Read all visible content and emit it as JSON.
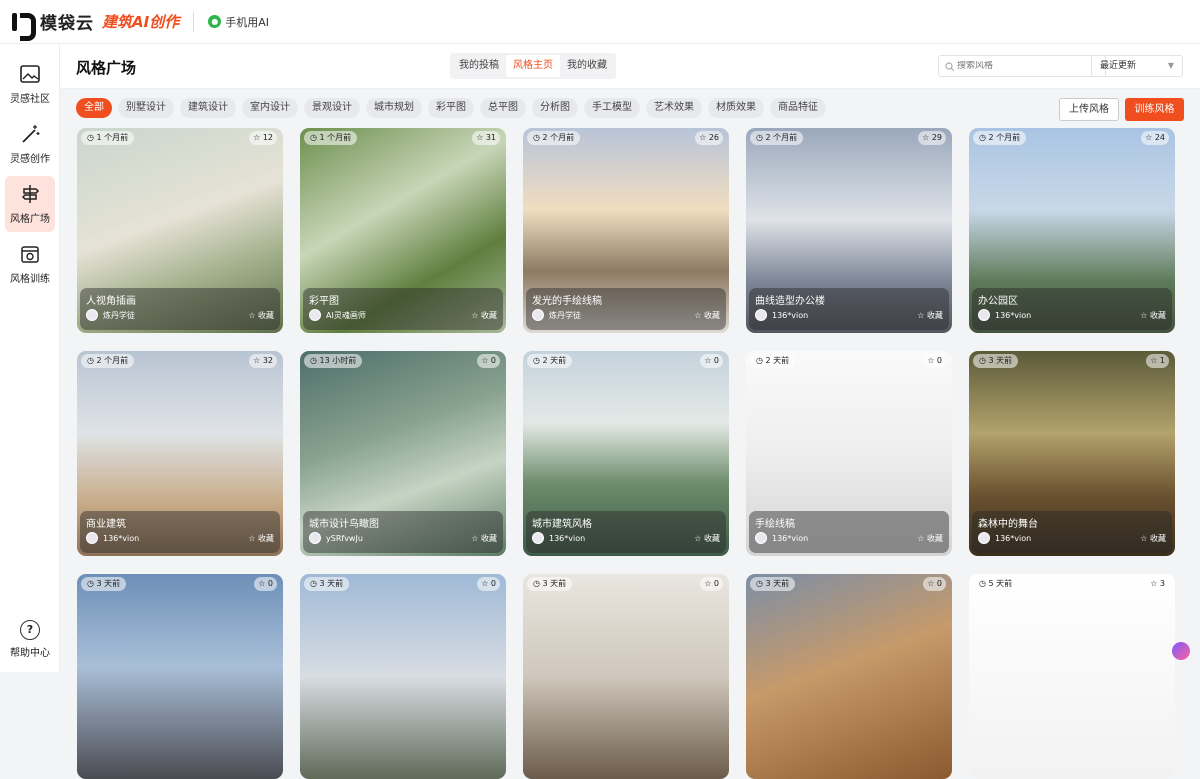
{
  "brand": {
    "name": "模袋云",
    "tagline": "建筑AI创作",
    "mobile_label": "手机用AI"
  },
  "sidebar": {
    "items": [
      {
        "label": "灵感社区"
      },
      {
        "label": "灵感创作"
      },
      {
        "label": "风格广场"
      },
      {
        "label": "风格训练"
      }
    ],
    "help_label": "帮助中心"
  },
  "header": {
    "title": "风格广场",
    "tabs": [
      {
        "label": "我的投稿"
      },
      {
        "label": "风格主页"
      },
      {
        "label": "我的收藏"
      }
    ],
    "search_placeholder": "搜索风格",
    "sort_value": "最近更新"
  },
  "categories": [
    "全部",
    "别墅设计",
    "建筑设计",
    "室内设计",
    "景观设计",
    "城市规划",
    "彩平图",
    "总平图",
    "分析图",
    "手工模型",
    "艺术效果",
    "材质效果",
    "商品特征"
  ],
  "buttons": {
    "upload": "上传风格",
    "train": "训练风格"
  },
  "fav_label": "收藏",
  "cards": [
    {
      "time": "1 个月前",
      "likes": "12",
      "title": "人视角插画",
      "user": "炼丹学徒",
      "bg": "linear-gradient(160deg,#c9d6cc 0%,#e6e2d6 45%,#a3b08c 70%,#5f6f4b 100%)"
    },
    {
      "time": "1 个月前",
      "likes": "31",
      "title": "彩平图",
      "user": "AI灵魂画师",
      "bg": "linear-gradient(150deg,#6d8f4e 0%,#c8d6b8 40%,#5f7f3e 70%,#a9b89a 100%)"
    },
    {
      "time": "2 个月前",
      "likes": "26",
      "title": "发光的手绘线稿",
      "user": "炼丹学徒",
      "bg": "linear-gradient(180deg,#b8c4d8 0%,#f1ddc0 40%,#8e7a63 70%,#dedad4 100%)"
    },
    {
      "time": "2 个月前",
      "likes": "29",
      "title": "曲线造型办公楼",
      "user": "136*vion",
      "bg": "linear-gradient(180deg,#9aa8bc 0%,#dfe3e8 45%,#7d8596 75%,#55565e 100%)"
    },
    {
      "time": "2 个月前",
      "likes": "24",
      "title": "办公园区",
      "user": "136*vion",
      "bg": "linear-gradient(180deg,#a9c4e3 0%,#c9d8e8 40%,#5e7a58 75%,#44513f 100%)"
    },
    {
      "time": "2 个月前",
      "likes": "32",
      "title": "商业建筑",
      "user": "136*vion",
      "bg": "linear-gradient(180deg,#b9c4d2 0%,#dfe3e7 40%,#c7a986 75%,#8c7258 100%)"
    },
    {
      "time": "13 小时前",
      "likes": "0",
      "title": "城市设计鸟瞰图",
      "user": "ySRfvwJu",
      "bg": "linear-gradient(160deg,#4f6e6b 0%,#88a28f 40%,#c6d4c4 65%,#5a7b63 100%)"
    },
    {
      "time": "2 天前",
      "likes": "0",
      "title": "城市建筑风格",
      "user": "136*vion",
      "bg": "linear-gradient(180deg,#c4d2dc 0%,#e4e9e6 35%,#6c8c6a 65%,#3f5a49 100%)"
    },
    {
      "time": "2 天前",
      "likes": "0",
      "title": "手绘线稿",
      "user": "136*vion",
      "bg": "linear-gradient(180deg,#fafafa 0%,#eeeeee 50%,#d4d4d4 100%)"
    },
    {
      "time": "3 天前",
      "likes": "1",
      "title": "森林中的舞台",
      "user": "136*vion",
      "bg": "linear-gradient(180deg,#5b5a38 0%,#b3a36d 40%,#6b5230 70%,#3a2f1e 100%)"
    },
    {
      "time": "3 天前",
      "likes": "0",
      "title": "",
      "user": "",
      "bg": "linear-gradient(180deg,#6d8fb8 0%,#a9bfd8 45%,#4b4b52 100%)"
    },
    {
      "time": "3 天前",
      "likes": "0",
      "title": "",
      "user": "",
      "bg": "linear-gradient(180deg,#9fb9d6 0%,#d8dde3 50%,#5f6a58 100%)"
    },
    {
      "time": "3 天前",
      "likes": "0",
      "title": "",
      "user": "",
      "bg": "linear-gradient(180deg,#e9e6e0 0%,#cfc7bb 50%,#6b5b4a 100%)"
    },
    {
      "time": "3 天前",
      "likes": "0",
      "title": "",
      "user": "",
      "bg": "linear-gradient(160deg,#7c8ea6 0%,#c79a6a 45%,#8b5a2f 100%)"
    },
    {
      "time": "5 天前",
      "likes": "3",
      "title": "",
      "user": "",
      "bg": "linear-gradient(180deg,#ffffff 0%,#f2f2f2 100%)"
    }
  ]
}
